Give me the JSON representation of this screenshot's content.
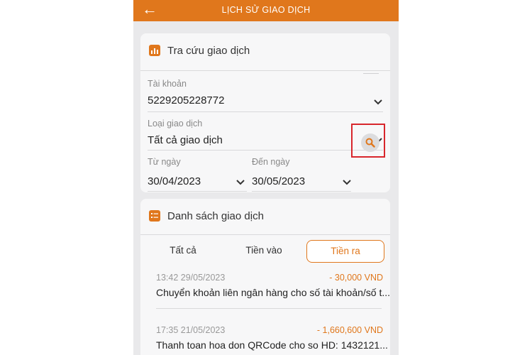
{
  "header": {
    "title": "LỊCH SỬ GIAO DỊCH",
    "back_icon": "arrow-left-icon"
  },
  "search_card": {
    "title": "Tra cứu giao dịch",
    "account": {
      "label": "Tài khoản",
      "value": "5229205228772"
    },
    "transaction_type": {
      "label": "Loại giao dịch",
      "value": "Tất cả giao dịch"
    },
    "from_date": {
      "label": "Từ ngày",
      "value": "30/04/2023"
    },
    "to_date": {
      "label": "Đến ngày",
      "value": "30/05/2023"
    },
    "search_icon": "search-icon"
  },
  "list_card": {
    "title": "Danh sách giao dịch",
    "tabs": [
      {
        "label": "Tất cả",
        "active": false
      },
      {
        "label": "Tiền vào",
        "active": false
      },
      {
        "label": "Tiền ra",
        "active": true
      }
    ],
    "transactions": [
      {
        "time": "13:42 29/05/2023",
        "amount": "- 30,000 VND",
        "description": "Chuyển khoản liên ngân hàng cho số tài khoản/số t..."
      },
      {
        "time": "17:35 21/05/2023",
        "amount": "- 1,660,600 VND",
        "description": "Thanh toan hoa don QRCode cho so HD: 1432121..."
      }
    ]
  },
  "colors": {
    "accent": "#e0771c",
    "highlight_box": "#d8262c",
    "background": "#e9e9eb"
  }
}
